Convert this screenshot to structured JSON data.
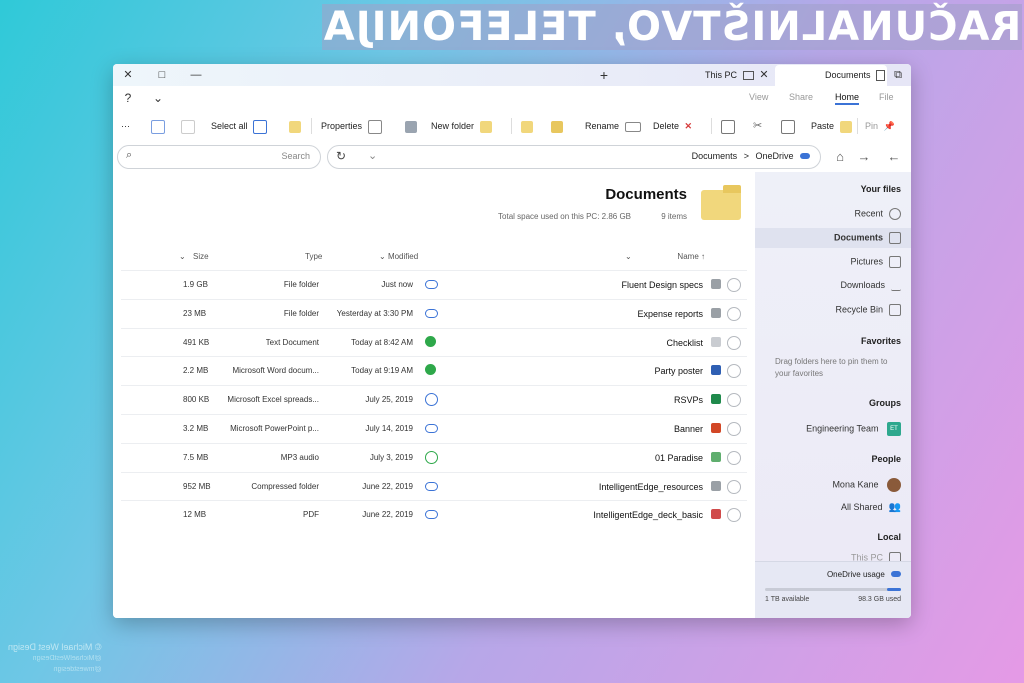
{
  "banner": {
    "title": "RAČUNALNIŠTVO, TELEFONIJA"
  },
  "watermark": {
    "line1": "© Michael West Design",
    "line2": "@MichaelWestDesign",
    "line3": "@mwestdesign"
  },
  "titlebar": {
    "tab_active": "Documents",
    "tab_other": "This PC",
    "new_tab": "+",
    "min": "—",
    "max": "□",
    "close": "✕",
    "restore": "⧉"
  },
  "menu": {
    "file": "File",
    "home": "Home",
    "share": "Share",
    "view": "View",
    "help": "?",
    "expand": "⌄"
  },
  "toolbar": {
    "pin": "Pin",
    "paste": "Paste",
    "delete": "Delete",
    "rename": "Rename",
    "new_folder": "New folder",
    "properties": "Properties",
    "select_all": "Select all",
    "more": "···"
  },
  "address": {
    "path_root": "OneDrive",
    "path_sep": ">",
    "path_current": "Documents",
    "search_placeholder": "Search"
  },
  "folder": {
    "title": "Documents",
    "items": "9 items",
    "space": "Total space used on this PC: 2.86 GB"
  },
  "columns": {
    "name": "Name",
    "modified": "Modified",
    "type": "Type",
    "size": "Size"
  },
  "files": [
    {
      "name": "Fluent Design specs",
      "modified": "Just now",
      "type": "File folder",
      "size": "1.9 GB",
      "status": "cloud",
      "icon": "folder-icon",
      "color": "#9aa0a6"
    },
    {
      "name": "Expense reports",
      "modified": "Yesterday at 3:30 PM",
      "type": "File folder",
      "size": "23 MB",
      "status": "cloud",
      "icon": "folder-icon",
      "color": "#9aa0a6"
    },
    {
      "name": "Checklist",
      "modified": "Today at 8:42 AM",
      "type": "Text Document",
      "size": "491 KB",
      "status": "green",
      "icon": "text-file-icon",
      "color": "#c9ccd1"
    },
    {
      "name": "Party poster",
      "modified": "Today at 9:19 AM",
      "type": "Microsoft Word docum...",
      "size": "2.2 MB",
      "status": "green",
      "icon": "word-file-icon",
      "color": "#2f5fb3"
    },
    {
      "name": "RSVPs",
      "modified": "July 25, 2019",
      "type": "Microsoft Excel spreads...",
      "size": "800 KB",
      "status": "sync",
      "icon": "excel-file-icon",
      "color": "#1f8a4c"
    },
    {
      "name": "Banner",
      "modified": "July 14, 2019",
      "type": "Microsoft PowerPoint p...",
      "size": "3.2 MB",
      "status": "cloud",
      "icon": "powerpoint-file-icon",
      "color": "#d24726"
    },
    {
      "name": "01 Paradise",
      "modified": "July 3, 2019",
      "type": "MP3 audio",
      "size": "7.5 MB",
      "status": "check",
      "icon": "audio-file-icon",
      "color": "#5fae6e"
    },
    {
      "name": "IntelligentEdge_resources",
      "modified": "June 22, 2019",
      "type": "Compressed folder",
      "size": "952 MB",
      "status": "cloud",
      "icon": "zip-folder-icon",
      "color": "#9aa0a6"
    },
    {
      "name": "IntelligentEdge_deck_basic",
      "modified": "June 22, 2019",
      "type": "PDF",
      "size": "12 MB",
      "status": "cloud",
      "icon": "pdf-file-icon",
      "color": "#d04a4a"
    }
  ],
  "sidebar": {
    "your_files": "Your files",
    "recent": "Recent",
    "documents": "Documents",
    "pictures": "Pictures",
    "downloads": "Downloads",
    "recycle_bin": "Recycle Bin",
    "favorites": "Favorites",
    "favorites_hint": "Drag folders here to pin them to your favorites",
    "groups": "Groups",
    "engineering_team": "Engineering Team",
    "engineering_badge": "ET",
    "people": "People",
    "mona_kane": "Mona Kane",
    "all_shared": "All Shared",
    "local": "Local",
    "this_pc": "This PC",
    "usage_title": "OneDrive usage",
    "usage_used": "98.3 GB used",
    "usage_avail": "1 TB available",
    "usage_fraction": 0.1
  },
  "colors": {
    "accent": "#3b73d6",
    "green": "#2ea84a"
  }
}
